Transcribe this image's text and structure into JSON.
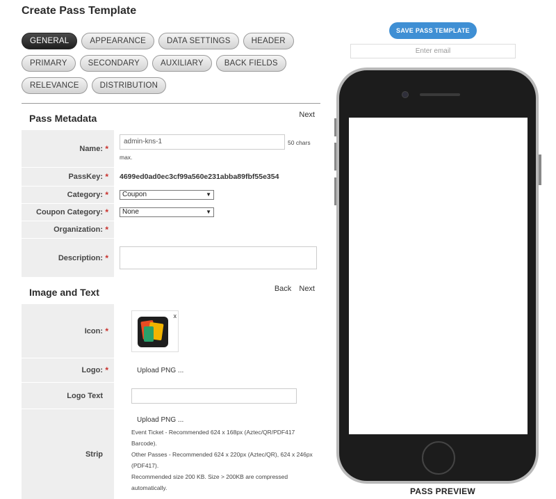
{
  "page_title": "Create Pass Template",
  "tabs": [
    [
      "GENERAL",
      "APPEARANCE",
      "DATA SETTINGS",
      "HEADER"
    ],
    [
      "PRIMARY",
      "SECONDARY",
      "AUXILIARY",
      "BACK FIELDS"
    ],
    [
      "RELEVANCE",
      "DISTRIBUTION"
    ]
  ],
  "active_tab": "GENERAL",
  "metadata": {
    "title": "Pass Metadata",
    "next": "Next",
    "name_label": "Name:",
    "name_value": "admin-kns-1",
    "name_hint_a": "50 chars",
    "name_hint_b": "max.",
    "passkey_label": "PassKey:",
    "passkey_value": "4699ed0ad0ec3cf99a560e231abba89fbf55e354",
    "category_label": "Category:",
    "category_value": "Coupon",
    "coupon_category_label": "Coupon Category:",
    "coupon_category_value": "None",
    "organization_label": "Organization:",
    "description_label": "Description:"
  },
  "image_text": {
    "title": "Image and Text",
    "back": "Back",
    "next": "Next",
    "icon_label": "Icon:",
    "icon_close": "x",
    "logo_label": "Logo:",
    "logo_upload": "Upload PNG ...",
    "logo_text_label": "Logo Text",
    "strip_label": "Strip",
    "strip_upload": "Upload PNG ...",
    "strip_lines": [
      "Event Ticket - Recommended 624 x 168px (Aztec/QR/PDF417",
      "Barcode).",
      "Other Passes - Recommended 624 x 220px (Aztec/QR), 624 x 246px",
      "(PDF417).",
      "Recommended size 200 KB. Size > 200KB are compressed",
      "automatically."
    ]
  },
  "preview": {
    "save_button": "SAVE PASS TEMPLATE",
    "email_placeholder": "Enter email",
    "label": "PASS PREVIEW"
  },
  "required_mark": "*",
  "colors": {
    "accent": "#3f8fd4",
    "required": "#c9302c",
    "label_bg": "#eeeeee"
  }
}
